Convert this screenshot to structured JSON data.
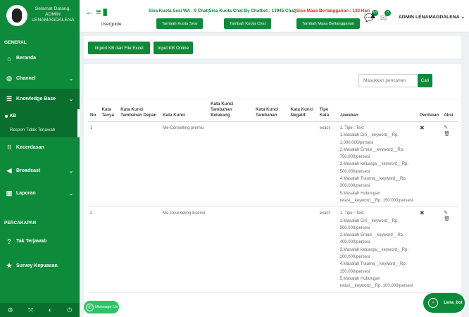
{
  "sidebar": {
    "greeting": "Selamat Datang,",
    "user": "ADMIN LENAMAGDALENA",
    "section_general": "GENERAL",
    "items": [
      {
        "label": "Beranda",
        "icon": "home-icon"
      },
      {
        "label": "Channel",
        "icon": "channel-icon"
      },
      {
        "label": "Knowledge Base",
        "icon": "database-icon"
      },
      {
        "label": "Kecerdasan",
        "icon": "intelligence-icon"
      },
      {
        "label": "Broadcast",
        "icon": "megaphone-icon"
      },
      {
        "label": "Laporan",
        "icon": "chart-icon"
      }
    ],
    "sub_items": [
      "KB",
      "Respon Tidak Terjawab"
    ],
    "section_percakapan": "PERCAKAPAN",
    "items2": [
      {
        "label": "Tak Terjawab",
        "icon": "question-icon"
      },
      {
        "label": "Survey Kepuasan",
        "icon": "star-icon"
      }
    ]
  },
  "topbar": {
    "userguide": "Userguide",
    "quota_wa": "Sisa Kuota Sesi WA : 0 Chat",
    "quota_bot": "|Sisa Kuota Chat By Chatbot : 13945 Chat",
    "quota_period": "|Sisa Masa Berlangganan : 133 Hari",
    "btn_sesi": "Tambah Kuota Sesi",
    "btn_chat": "Tambah Kuota Chat",
    "btn_masa": "Tambah Masa Berlangganan",
    "notif_count_1": "10",
    "notif_count_2": "0",
    "admin_name": "ADMIN LENAMAGDALENA"
  },
  "actions": {
    "import_excel": "Import KB dari File Excel",
    "input_online": "Input KB Online"
  },
  "search": {
    "placeholder": "Masukkan pencarian",
    "button": "Cari"
  },
  "table": {
    "headers": [
      "No",
      "Kata Tanya",
      "Kata Kunci Tambahan Depan",
      "Kata Kunci",
      "Kata Kunci Tambahan Belakang",
      "Kata Kunci Tambahan",
      "Kata Kunci Negatif",
      "Tipe Kata",
      "Jawaban",
      "Penilaian",
      "Aksi"
    ],
    "rows": [
      {
        "no": "1",
        "kata_kunci": "Me-Conselling premiu",
        "tipe": "exact",
        "jawaban": [
          "1. Tipe : Text",
          "1.Masalah Diri__keyword__Rp.",
          "1.000.000/persesi",
          "2.Masalah Emosi__keyword__Rp.",
          "750.000/persesi",
          "3.Masalah keluarga__keyword__Rp.",
          "500.000/persesi",
          "4.Masalah Trauma__keyword__Rp.",
          "300.000/persesi",
          "5.Masalah Hubungan",
          "relasi__keyword__Rp. 150.000/persesi"
        ]
      },
      {
        "no": "2",
        "kata_kunci": "Me-Counseling Esensi",
        "tipe": "exact",
        "jawaban": [
          "1. Tipe : Text",
          "1.Masalah Diri__keyword__Rp.",
          "500.000/persesi",
          "2.Masalah Emosi__keyword__Rp.",
          "400.000/persesi",
          "3.Masalah keluarga__keyword__Rp.",
          "200.000/persesi",
          "4.Masalah Trauma__keyword__Rp.",
          "150.000/persesi",
          "5.Masalah Hubungan",
          "relasi__keyword__Rp. 100.000/persesi"
        ]
      }
    ]
  },
  "float": {
    "message_us": "Message Us",
    "bot_name": "Lena_bot"
  },
  "colors": {
    "brand_green": "#0d8a3a",
    "alert_red": "#e52a2a"
  }
}
